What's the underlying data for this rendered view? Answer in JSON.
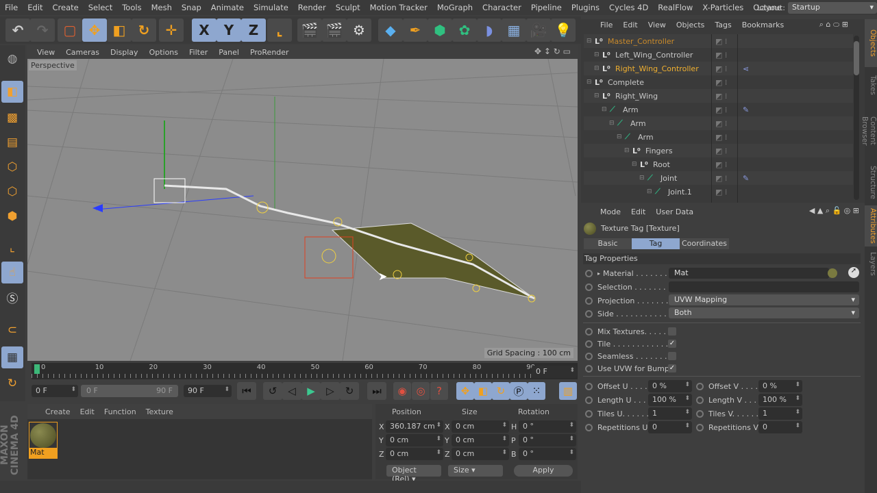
{
  "menu": [
    "File",
    "Edit",
    "Create",
    "Select",
    "Tools",
    "Mesh",
    "Snap",
    "Animate",
    "Simulate",
    "Render",
    "Sculpt",
    "Motion Tracker",
    "MoGraph",
    "Character",
    "Pipeline",
    "Plugins",
    "Cycles 4D",
    "RealFlow",
    "X-Particles",
    "Octane"
  ],
  "layout": {
    "label": "Layout:",
    "value": "Startup"
  },
  "toolbar": {
    "x": "X",
    "y": "Y",
    "z": "Z"
  },
  "viewport": {
    "menu": [
      "View",
      "Cameras",
      "Display",
      "Options",
      "Filter",
      "Panel",
      "ProRender"
    ],
    "camera": "Perspective",
    "grid_spacing": "Grid Spacing : 100 cm"
  },
  "timeline": {
    "ticks": [
      "0",
      "10",
      "20",
      "30",
      "40",
      "50",
      "60",
      "70",
      "80",
      "90"
    ],
    "current": "0 F",
    "start": "0 F",
    "range_start": "0 F",
    "range_end": "90 F",
    "end": "90 F"
  },
  "material_manager": {
    "menu": [
      "Create",
      "Edit",
      "Function",
      "Texture"
    ],
    "materials": [
      {
        "name": "Mat"
      }
    ]
  },
  "coordinates": {
    "headers": [
      "Position",
      "Size",
      "Rotation"
    ],
    "pos": {
      "x": "360.187 cm",
      "y": "0 cm",
      "z": "0 cm"
    },
    "size": {
      "x": "0 cm",
      "y": "0 cm",
      "z": "0 cm"
    },
    "rot": {
      "h": "0 °",
      "p": "0 °",
      "b": "0 °"
    },
    "axis_pos": [
      "X",
      "Y",
      "Z"
    ],
    "axis_rot": [
      "H",
      "P",
      "B"
    ],
    "mode": "Object (Rel)",
    "size_mode": "Size",
    "apply": "Apply"
  },
  "branding": "MAXON CINEMA 4D",
  "object_manager": {
    "menu": [
      "File",
      "Edit",
      "View",
      "Objects",
      "Tags",
      "Bookmarks"
    ],
    "objects": [
      {
        "name": "Master_Controller",
        "depth": 0,
        "type": "null",
        "color": "#c98a2a",
        "tag": ""
      },
      {
        "name": "Left_Wing_Controller",
        "depth": 1,
        "type": "null",
        "color": "#c8c8c8",
        "tag": ""
      },
      {
        "name": "Right_Wing_Controller",
        "depth": 1,
        "type": "null",
        "color": "#f0b030",
        "tag": "hierarchy-tag"
      },
      {
        "name": "Complete",
        "depth": 0,
        "type": "null",
        "color": "#c8c8c8",
        "tag": ""
      },
      {
        "name": "Right_Wing",
        "depth": 1,
        "type": "null",
        "color": "#c8c8c8",
        "tag": ""
      },
      {
        "name": "Arm",
        "depth": 2,
        "type": "joint",
        "color": "#c8c8c8",
        "tag": "ik-tag"
      },
      {
        "name": "Arm",
        "depth": 3,
        "type": "joint",
        "color": "#c8c8c8",
        "tag": ""
      },
      {
        "name": "Arm",
        "depth": 4,
        "type": "joint",
        "color": "#c8c8c8",
        "tag": ""
      },
      {
        "name": "Fingers",
        "depth": 5,
        "type": "null",
        "color": "#c8c8c8",
        "tag": ""
      },
      {
        "name": "Root",
        "depth": 6,
        "type": "null",
        "color": "#c8c8c8",
        "tag": ""
      },
      {
        "name": "Joint",
        "depth": 7,
        "type": "joint",
        "color": "#c8c8c8",
        "tag": "ik-tag"
      },
      {
        "name": "Joint.1",
        "depth": 8,
        "type": "joint",
        "color": "#c8c8c8",
        "tag": ""
      }
    ]
  },
  "side_tabs": {
    "objects": "Objects",
    "takes": "Takes",
    "content": "Content Browser",
    "structure": "Structure",
    "attributes": "Attributes",
    "layers": "Layers"
  },
  "attributes": {
    "menu": [
      "Mode",
      "Edit",
      "User Data"
    ],
    "title": "Texture Tag [Texture]",
    "tabs": [
      "Basic",
      "Tag",
      "Coordinates"
    ],
    "active_tab": "Tag",
    "section": "Tag Properties",
    "material": {
      "label": "Material . . . . . . .",
      "value": "Mat"
    },
    "selection": {
      "label": "Selection . . . . . . . .",
      "value": ""
    },
    "projection": {
      "label": "Projection . . . . . . .",
      "value": "UVW Mapping"
    },
    "side": {
      "label": "Side . . . . . . . . . . .",
      "value": "Both"
    },
    "checks": [
      {
        "label": "Mix Textures. . . . . .",
        "checked": false
      },
      {
        "label": "Tile . . . . . . . . . . . .",
        "checked": true
      },
      {
        "label": "Seamless . . . . . . . .",
        "checked": false
      },
      {
        "label": "Use UVW for Bump",
        "checked": true
      }
    ],
    "numeric": [
      {
        "label": "Offset U . . . .",
        "value": "0 %",
        "label2": "Offset V . . . .",
        "value2": "0 %"
      },
      {
        "label": "Length U . . .",
        "value": "100 %",
        "label2": "Length V . . .",
        "value2": "100 %"
      },
      {
        "label": "Tiles U. . . . . .",
        "value": "1",
        "label2": "Tiles V. . . . . .",
        "value2": "1"
      },
      {
        "label": "Repetitions U",
        "value": "0",
        "label2": "Repetitions V",
        "value2": "0"
      }
    ]
  }
}
